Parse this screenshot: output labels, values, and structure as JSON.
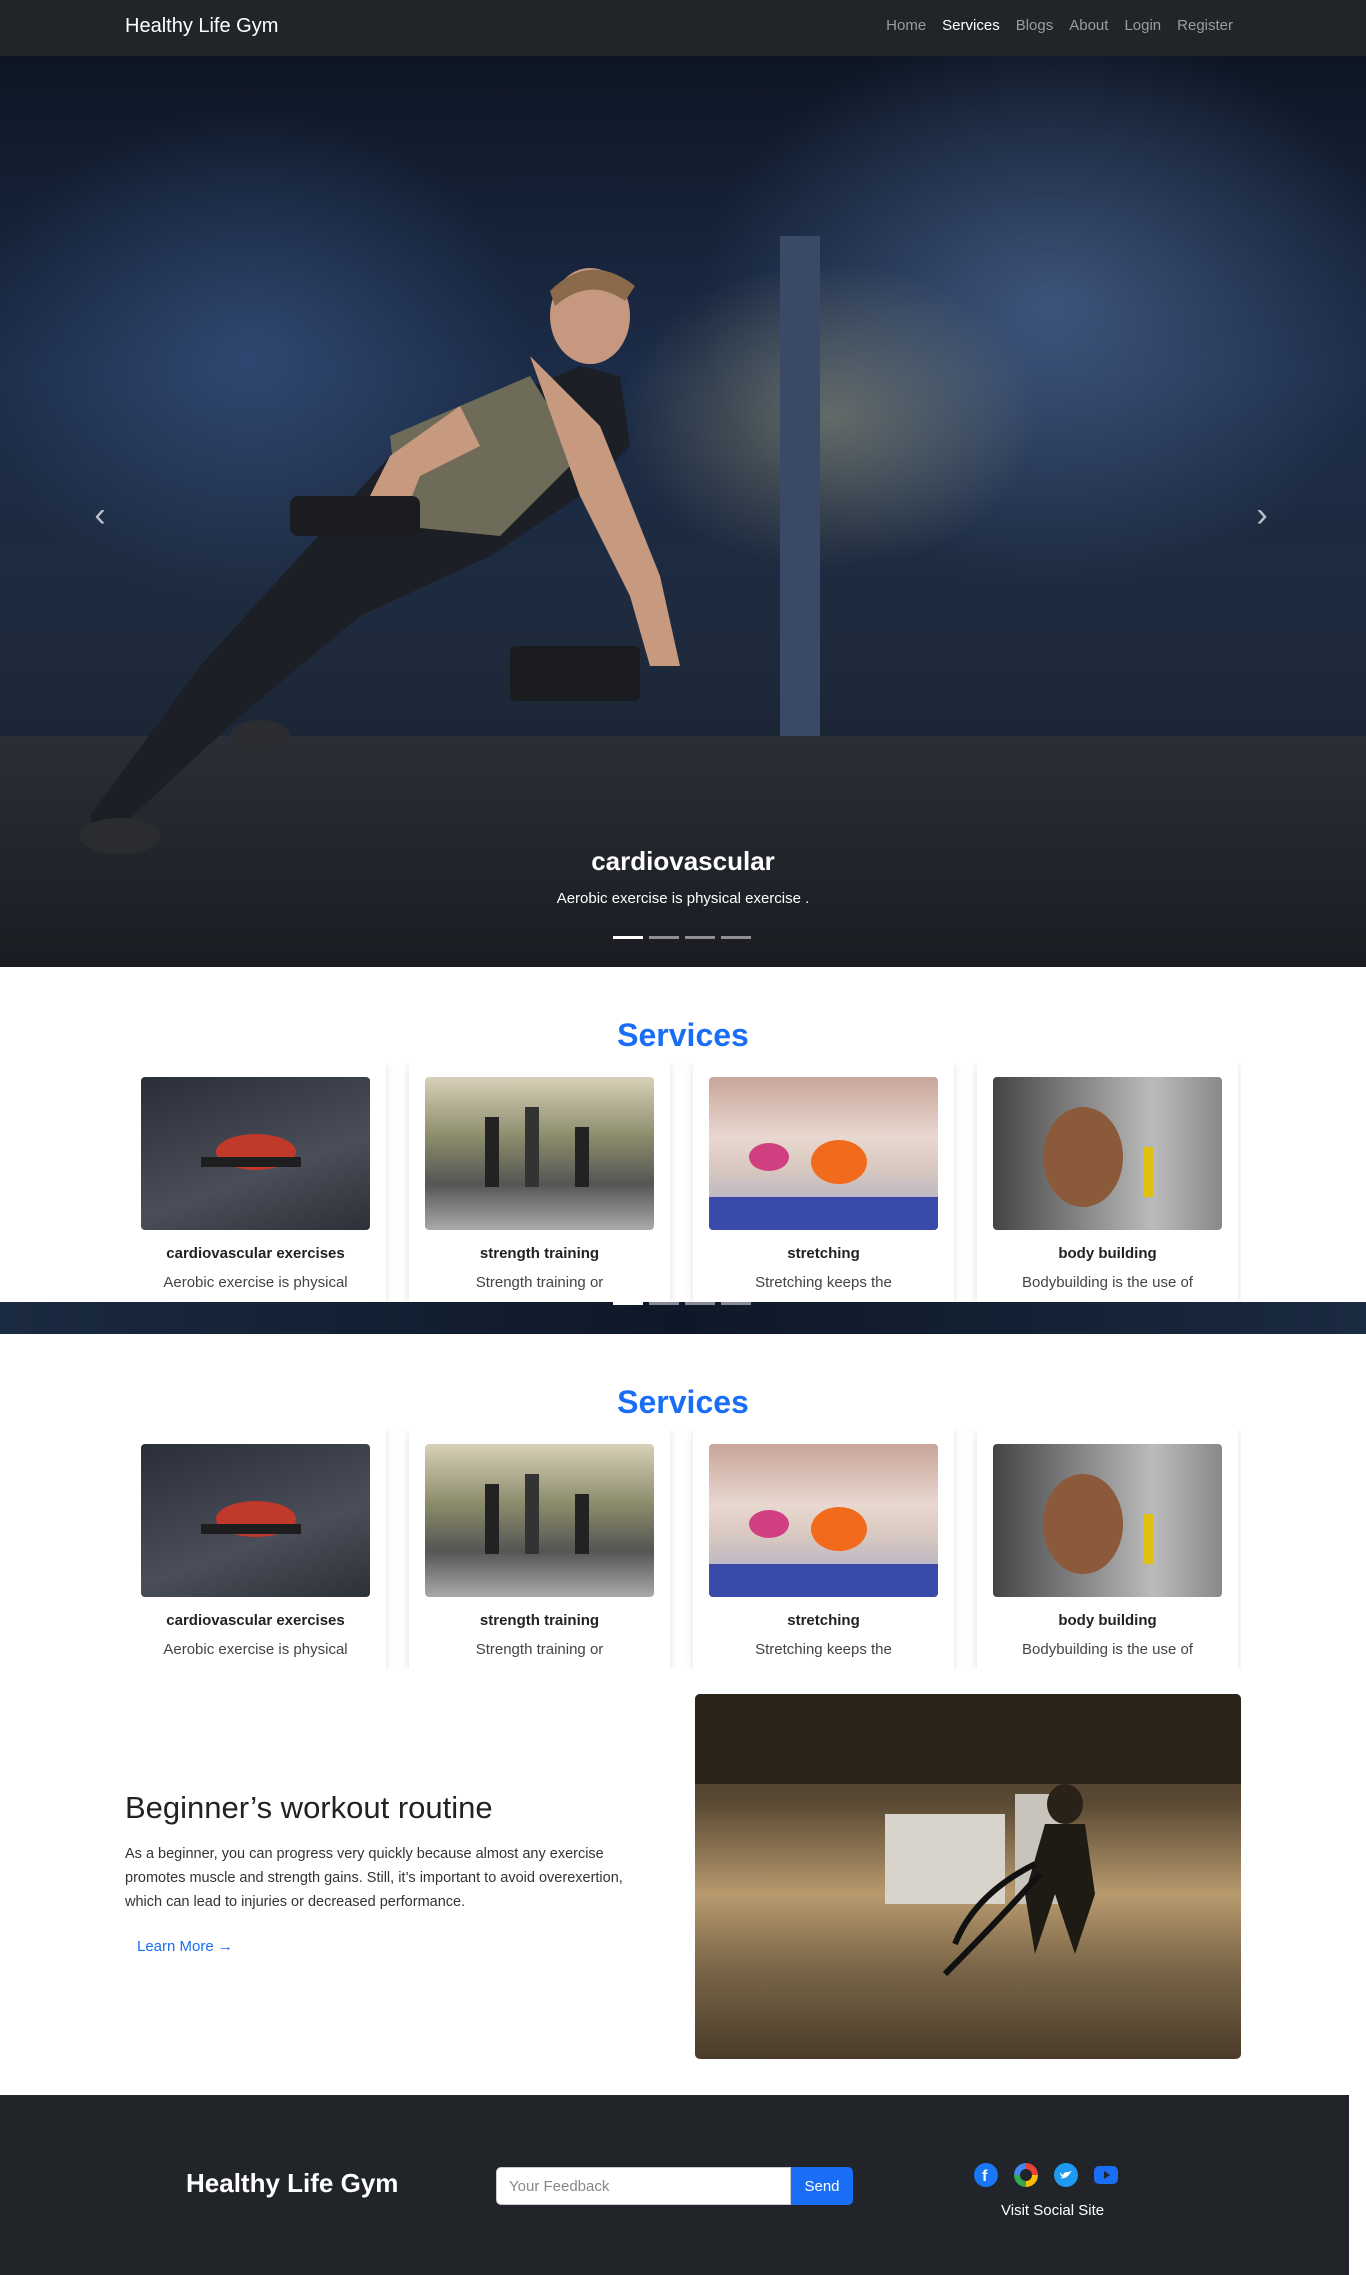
{
  "nav": {
    "brand": "Healthy Life Gym",
    "links": [
      "Home",
      "Services",
      "Blogs",
      "About",
      "Login",
      "Register"
    ],
    "active": "Services"
  },
  "hero": {
    "title": "cardiovascular",
    "text": "Aerobic exercise is physical exercise .",
    "prev_icon": "chevron-left-icon",
    "next_icon": "chevron-right-icon",
    "slides": 4,
    "active_slide": 1
  },
  "services": {
    "title": "Services",
    "cards": [
      {
        "title": "cardiovascular exercises",
        "text": "Aerobic exercise is physical"
      },
      {
        "title": "strength training",
        "text": "Strength training or"
      },
      {
        "title": "stretching",
        "text": "Stretching keeps the"
      },
      {
        "title": "body building",
        "text": "Bodybuilding is the use of"
      }
    ]
  },
  "workout": {
    "title": "Beginner’s workout routine",
    "text": "As a beginner, you can progress very quickly because almost any exercise promotes muscle and strength gains. Still, it’s important to avoid overexertion, which can lead to injuries or decreased performance.",
    "link": "Learn More →"
  },
  "footer": {
    "brand": "Healthy Life Gym",
    "feedback_placeholder": "Your Feedback",
    "send_label": "Send",
    "social_icons": [
      "facebook-icon",
      "google-icon",
      "twitter-icon",
      "youtube-icon"
    ],
    "visit": "Visit Social Site"
  },
  "colors": {
    "accent": "#1a6ef5",
    "nav_bg": "#212529"
  }
}
